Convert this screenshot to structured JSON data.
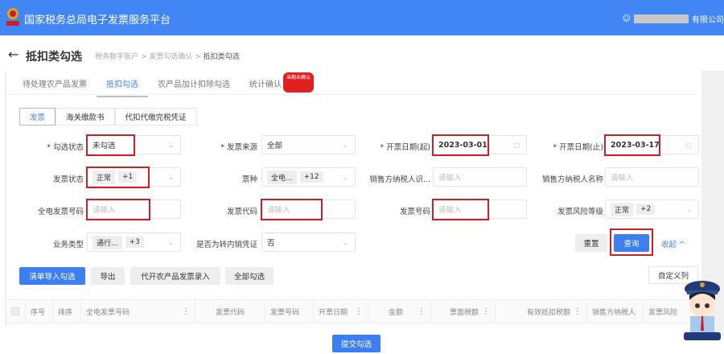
{
  "header": {
    "title": "国家税务总局电子发票服务平台",
    "company_suffix": "有限公司"
  },
  "page": {
    "back": "←",
    "title": "抵扣类勾选",
    "breadcrumb": [
      "税务数字账户",
      "发票勾选确认",
      "抵扣类勾选"
    ],
    "sep": ">"
  },
  "tabs": [
    {
      "label": "待处理农产品发票"
    },
    {
      "label": "抵扣勾选"
    },
    {
      "label": "农产品加计扣除勾选"
    },
    {
      "label": "统计确认"
    }
  ],
  "tab_badge": "当期未确认",
  "subtabs": [
    "发票",
    "海关缴款书",
    "代扣代缴完税凭证"
  ],
  "form": {
    "check_status": {
      "label": "* 勾选状态",
      "value": "未勾选"
    },
    "source": {
      "label": "* 发票来源",
      "value": "全部"
    },
    "date_start": {
      "label": "* 开票日期(起)",
      "value": "2023-03-01"
    },
    "date_end": {
      "label": "* 开票日期(止)",
      "value": "2023-03-17"
    },
    "invoice_status": {
      "label": "发票状态",
      "chip": "正常",
      "more": "+1"
    },
    "ticket_type": {
      "label": "票种",
      "chip": "全电...",
      "more": "+12"
    },
    "seller_id": {
      "label": "销售方纳税人识...",
      "placeholder": "请输入"
    },
    "seller_name": {
      "label": "销售方纳税人名称",
      "placeholder": "请输入"
    },
    "einvoice_no": {
      "label": "全电发票号码",
      "placeholder": "请输入"
    },
    "invoice_code": {
      "label": "发票代码",
      "placeholder": "请输入"
    },
    "invoice_no": {
      "label": "发票号码",
      "placeholder": "请输入"
    },
    "risk_level": {
      "label": "发票风险等级",
      "chip": "正常",
      "more": "+2"
    },
    "biz_type": {
      "label": "业务类型",
      "chip": "通行...",
      "more": "+3"
    },
    "transfer": {
      "label": "是否为转内销凭证",
      "value": "否"
    },
    "reset": "重置",
    "query": "查询",
    "collapse": "收起 ^"
  },
  "actions": [
    "清单导入勾选",
    "导出",
    "代开农产品发票录入",
    "全部勾选"
  ],
  "custom_columns": "自定义列",
  "table": {
    "columns": [
      "序号",
      "排序",
      "全电发票号码",
      "发票代码",
      "发票号码",
      "开票日期",
      "金额",
      "票面税额",
      "有效抵扣税额",
      "销售方纳税人",
      "发票风险"
    ]
  },
  "submit": "提交勾选"
}
